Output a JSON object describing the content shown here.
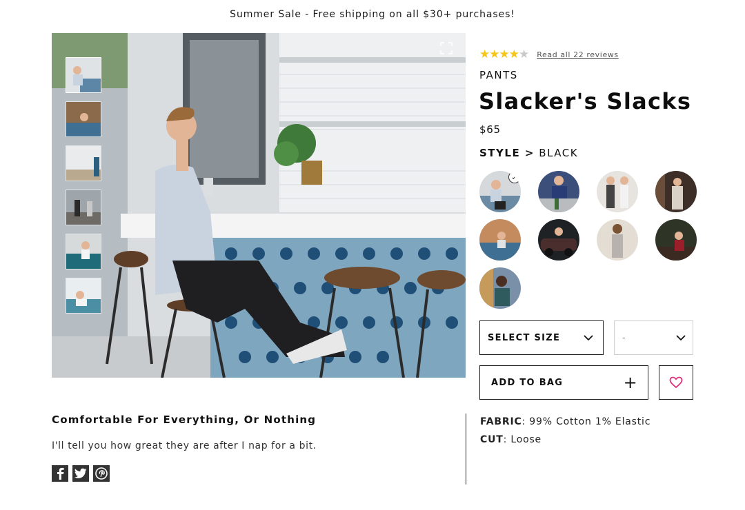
{
  "banner": {
    "text": "Summer Sale - Free shipping on all $30+ purchases!"
  },
  "rating": {
    "stars_filled": 4,
    "stars_total": 5,
    "reviews_link": "Read all 22 reviews"
  },
  "product": {
    "category": "PANTS",
    "name": "Slacker's Slacks",
    "price": "$65",
    "style_label": "STYLE >",
    "style_value": "BLACK"
  },
  "gallery": {
    "thumbnail_count": 6,
    "selected_thumbnail": 1
  },
  "swatches": {
    "count": 9,
    "selected_index": 1
  },
  "size_select": {
    "label": "SELECT SIZE"
  },
  "qty_select": {
    "value": "-"
  },
  "actions": {
    "add_to_bag": "ADD TO BAG",
    "plus": "+"
  },
  "description": {
    "title": "Comfortable For Everything, Or Nothing",
    "text": "I'll tell you how great they are after I nap for a bit."
  },
  "specs": {
    "fabric_label": "FABRIC",
    "fabric_value": ": 99% Cotton 1% Elastic",
    "cut_label": "CUT",
    "cut_value": ": Loose"
  },
  "social": [
    "facebook-icon",
    "twitter-icon",
    "pinterest-icon"
  ],
  "colors": {
    "accent_star": "#f5c518",
    "heart": "#e0307a",
    "text": "#111111"
  }
}
